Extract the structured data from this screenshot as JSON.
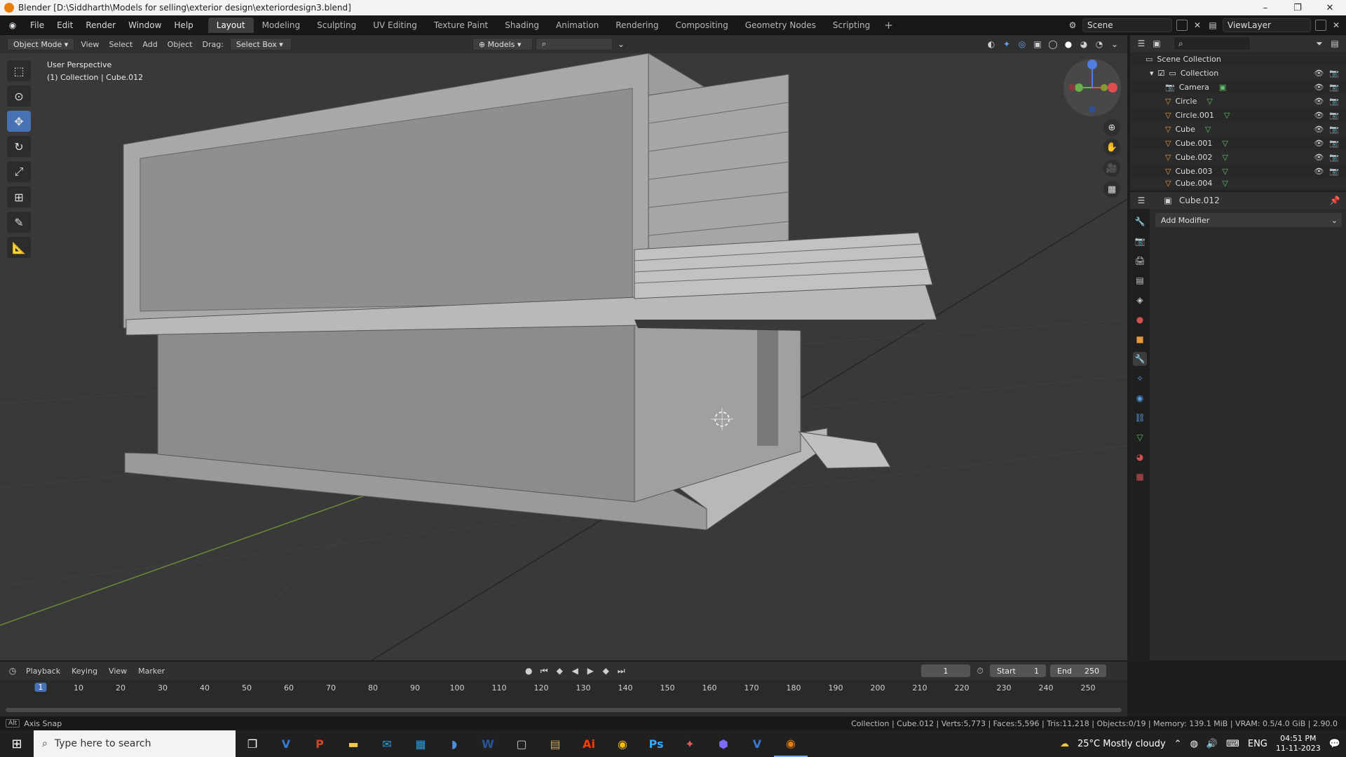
{
  "window": {
    "title": "Blender [D:\\Siddharth\\Models for selling\\exterior design\\exteriordesign3.blend]",
    "controls": [
      "–",
      "❐",
      "✕"
    ]
  },
  "menu": [
    "File",
    "Edit",
    "Render",
    "Window",
    "Help"
  ],
  "workspaces": [
    "Layout",
    "Modeling",
    "Sculpting",
    "UV Editing",
    "Texture Paint",
    "Shading",
    "Animation",
    "Rendering",
    "Compositing",
    "Geometry Nodes",
    "Scripting"
  ],
  "active_workspace": "Layout",
  "scene": "Scene",
  "view_layer": "ViewLayer",
  "viewport_header": {
    "mode": "Object Mode",
    "menus": [
      "View",
      "Select",
      "Add",
      "Object"
    ],
    "drag_label": "Drag:",
    "drag_value": "Select Box",
    "orientation": "Models"
  },
  "viewport_info": {
    "perspective": "User Perspective",
    "collection": "(1) Collection | Cube.012"
  },
  "outliner": {
    "root": "Scene Collection",
    "collection": "Collection",
    "items": [
      "Camera",
      "Circle",
      "Circle.001",
      "Cube",
      "Cube.001",
      "Cube.002",
      "Cube.003",
      "Cube.004"
    ]
  },
  "properties": {
    "object": "Cube.012",
    "add_modifier": "Add Modifier"
  },
  "timeline": {
    "menus": [
      "Playback",
      "Keying",
      "View",
      "Marker"
    ],
    "current_frame": "1",
    "start_label": "Start",
    "start": "1",
    "end_label": "End",
    "end": "250",
    "ticks": [
      "10",
      "20",
      "30",
      "40",
      "50",
      "60",
      "70",
      "80",
      "90",
      "100",
      "110",
      "120",
      "130",
      "140",
      "150",
      "160",
      "170",
      "180",
      "190",
      "200",
      "210",
      "220",
      "230",
      "240",
      "250"
    ]
  },
  "statusbar": {
    "left": "Axis Snap",
    "right": "Collection | Cube.012 | Verts:5,773 | Faces:5,596 | Tris:11,218 | Objects:0/19 | Memory: 139.1 MiB | VRAM: 0.5/4.0 GiB | 2.90.0"
  },
  "taskbar": {
    "search_placeholder": "Type here to search",
    "weather": "25°C  Mostly cloudy",
    "lang": "ENG",
    "time": "04:51 PM",
    "date": "11-11-2023"
  }
}
